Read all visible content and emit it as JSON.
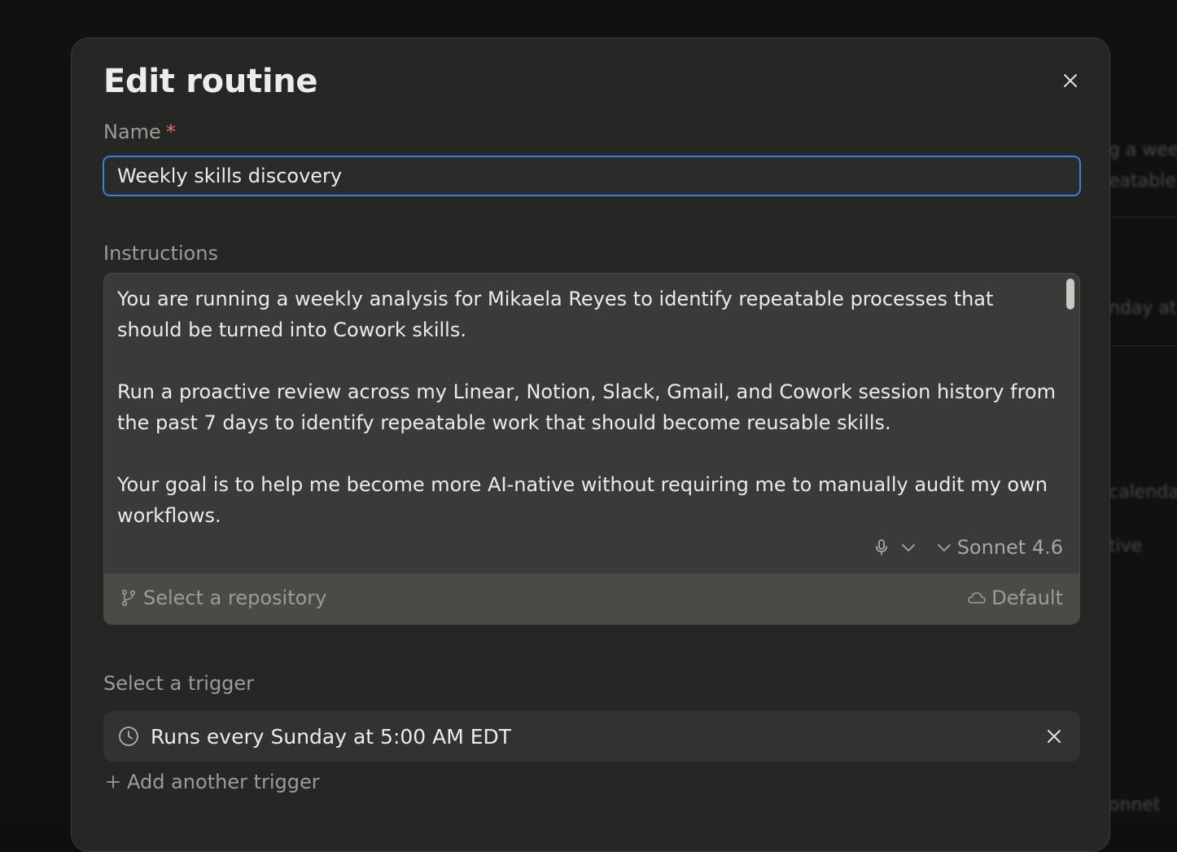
{
  "background": {
    "fragments": [
      "g a weel",
      "eatable",
      "nday at",
      "calenda",
      "tive",
      "onnet"
    ]
  },
  "dialog": {
    "title": "Edit routine",
    "close_icon": "close-icon"
  },
  "name_field": {
    "label": "Name",
    "required_marker": "*",
    "value": "Weekly skills discovery"
  },
  "instructions": {
    "label": "Instructions",
    "text": "You are running a weekly analysis for Mikaela Reyes to identify repeatable processes that\nshould be turned into Cowork skills.\n\nRun a proactive review across my Linear, Notion, Slack, Gmail, and Cowork session history from\nthe past 7 days to identify repeatable work that should become reusable skills.\n\nYour goal is to help me become more AI-native without requiring me to manually audit my own\nworkflows.",
    "model": "Sonnet 4.6",
    "repository_placeholder": "Select a repository",
    "environment": "Default"
  },
  "trigger": {
    "label": "Select a trigger",
    "schedule": "Runs every Sunday at 5:00 AM EDT",
    "add_label": "Add another trigger"
  },
  "colors": {
    "accent_focus": "#3b7fe0",
    "required": "#e5736b",
    "modal_bg": "#262624"
  }
}
